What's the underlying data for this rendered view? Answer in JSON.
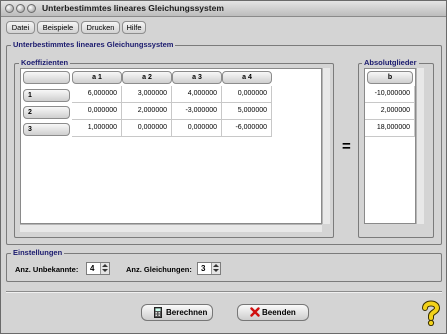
{
  "window": {
    "title": "Unterbestimmtes lineares Gleichungssystem"
  },
  "menu": [
    "Datei",
    "Beispiele",
    "Drucken",
    "Hilfe"
  ],
  "main_group": {
    "title": "Unterbestimmtes lineares Gleichungssystem"
  },
  "coefficients": {
    "title": "Koeffizienten",
    "columns": [
      "a 1",
      "a 2",
      "a 3",
      "a 4"
    ],
    "rows": [
      {
        "label": "1",
        "values": [
          "6,000000",
          "3,000000",
          "4,000000",
          "0,000000"
        ]
      },
      {
        "label": "2",
        "values": [
          "0,000000",
          "2,000000",
          "-3,000000",
          "5,000000"
        ]
      },
      {
        "label": "3",
        "values": [
          "1,000000",
          "0,000000",
          "0,000000",
          "-6,000000"
        ]
      }
    ]
  },
  "equals_sign": "=",
  "absolute_terms": {
    "title": "Absolutglieder",
    "column": "b",
    "values": [
      "-10,000000",
      "2,000000",
      "18,000000"
    ]
  },
  "settings": {
    "title": "Einstellungen",
    "unknowns_label": "Anz. Unbekannte:",
    "unknowns_value": "4",
    "equations_label": "Anz. Gleichungen:",
    "equations_value": "3"
  },
  "buttons": {
    "calculate": "Berechnen",
    "exit": "Beenden"
  },
  "colors": {
    "group_title": "#1a1a6e",
    "help_icon": "#f2d21a",
    "exit_icon": "#d01010"
  }
}
